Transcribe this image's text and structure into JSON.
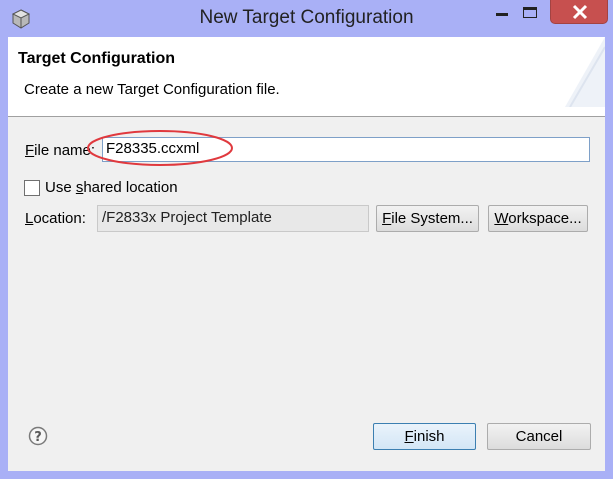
{
  "window": {
    "title": "New Target Configuration",
    "icon": "gear-cube-icon"
  },
  "banner": {
    "title": "Target Configuration",
    "description": "Create a new Target Configuration file."
  },
  "form": {
    "file_name_label_prefix": "F",
    "file_name_label_rest": "ile name:",
    "file_name_value": "F28335.ccxml",
    "shared_location_prefix": "Use ",
    "shared_location_u": "s",
    "shared_location_rest": "hared location",
    "shared_location_checked": false,
    "location_label_prefix": "L",
    "location_label_rest": "ocation:",
    "location_value": "/F2833x Project Template"
  },
  "buttons": {
    "file_system_prefix": "F",
    "file_system_rest": "ile System...",
    "workspace_prefix": "W",
    "workspace_rest": "orkspace...",
    "finish_prefix": "F",
    "finish_rest": "inish",
    "cancel": "Cancel"
  },
  "annotation": {
    "color": "#e0393e"
  },
  "colors": {
    "frame": "#a9b0f6",
    "close": "#c7504f"
  }
}
